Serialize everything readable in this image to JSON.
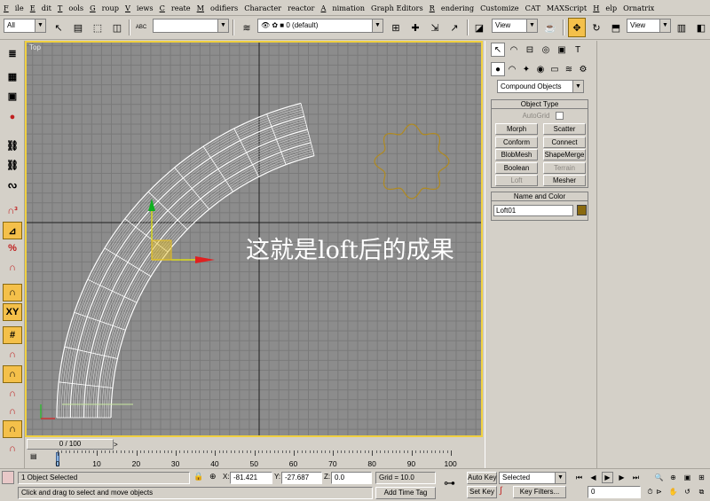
{
  "menu": [
    {
      "hot": "F",
      "rest": "ile"
    },
    {
      "hot": "E",
      "rest": "dit"
    },
    {
      "hot": "T",
      "rest": "ools"
    },
    {
      "hot": "G",
      "rest": "roup"
    },
    {
      "hot": "V",
      "rest": "iews"
    },
    {
      "hot": "C",
      "rest": "reate"
    },
    {
      "hot": "M",
      "rest": "odifiers"
    },
    {
      "hot": "",
      "rest": "Character"
    },
    {
      "hot": "",
      "rest": "reactor"
    },
    {
      "hot": "A",
      "rest": "nimation"
    },
    {
      "hot": "",
      "rest": "Graph Editors"
    },
    {
      "hot": "R",
      "rest": "endering"
    },
    {
      "hot": "",
      "rest": "Customize"
    },
    {
      "hot": "",
      "rest": "CAT"
    },
    {
      "hot": "",
      "rest": "MAXScript"
    },
    {
      "hot": "H",
      "rest": "elp"
    },
    {
      "hot": "",
      "rest": "Ornatrix"
    }
  ],
  "toolbar": {
    "selection_filter": "All",
    "named_selection": "",
    "layer": "0 (default)",
    "ref_coord_1": "View",
    "ref_coord_2": "View",
    "abc_label": "ABC"
  },
  "viewport": {
    "label": "Top",
    "caption": "这就是loft后的成果"
  },
  "command_panel": {
    "category": "Compound Objects",
    "object_type_title": "Object Type",
    "autogrid_label": "AutoGrid",
    "buttons": [
      {
        "label": "Morph",
        "enabled": true
      },
      {
        "label": "Scatter",
        "enabled": true
      },
      {
        "label": "Conform",
        "enabled": true
      },
      {
        "label": "Connect",
        "enabled": true
      },
      {
        "label": "BlobMesh",
        "enabled": true
      },
      {
        "label": "ShapeMerge",
        "enabled": true
      },
      {
        "label": "Boolean",
        "enabled": true
      },
      {
        "label": "Terrain",
        "enabled": false
      },
      {
        "label": "Loft",
        "enabled": false
      },
      {
        "label": "Mesher",
        "enabled": true
      }
    ],
    "name_color_title": "Name and Color",
    "object_name": "Loft01",
    "object_color": "#8a6a10"
  },
  "timeline": {
    "slider_label": "0 / 100",
    "ticks": [
      "0",
      "10",
      "20",
      "30",
      "40",
      "50",
      "60",
      "70",
      "80",
      "90",
      "100"
    ]
  },
  "status": {
    "selection_text": "1 Object Selected",
    "prompt_text": "Click and drag to select and move objects",
    "x_label": "X:",
    "x_value": "-81.421",
    "y_label": "Y:",
    "y_value": "-27.687",
    "z_label": "Z:",
    "z_value": "0.0",
    "grid": "Grid = 10.0",
    "add_time_tag": "Add Time Tag",
    "auto_key": "Auto Key",
    "set_key": "Set Key",
    "key_mode": "Selected",
    "key_filters": "Key Filters...",
    "frame": "0"
  },
  "colors": {
    "viewport_bg": "#8c8c8c",
    "active_border": "#f0d040",
    "star_shape": "#b08a20"
  }
}
